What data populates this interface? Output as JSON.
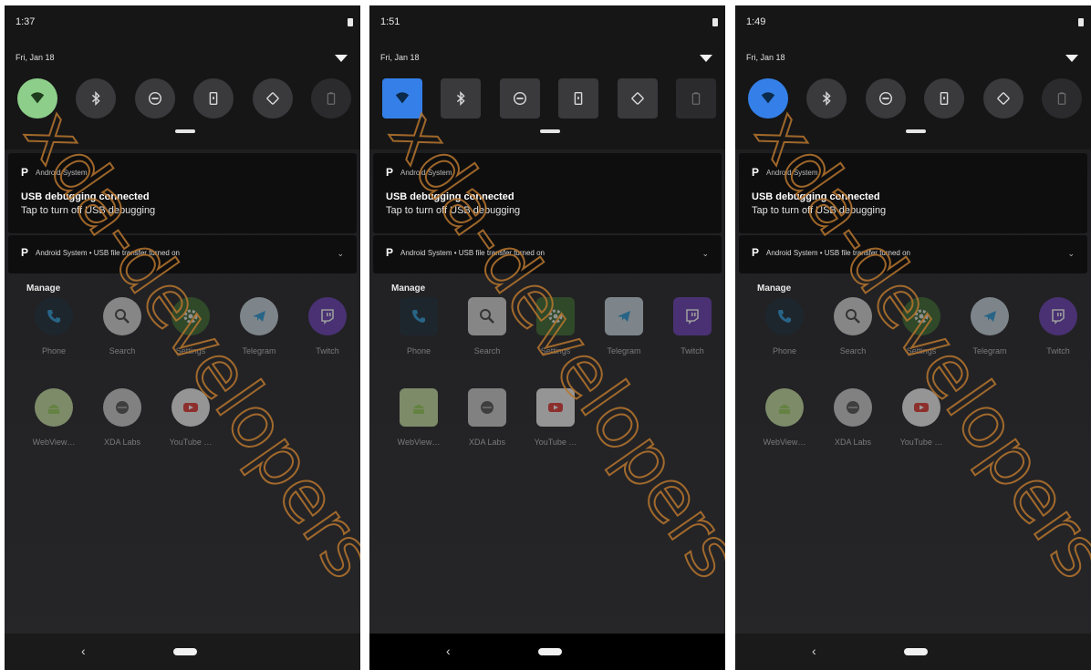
{
  "colors": {
    "tile_active_green": "#8dcf8a",
    "tile_active_blue": "#3480e8",
    "tile_inactive": "#3a3a3d",
    "watermark": "#b8762e"
  },
  "watermark_text": "xda-developers",
  "screens": [
    {
      "time": "1:37",
      "date": "Fri, Jan 18",
      "tile_style": "circle",
      "tiles": [
        {
          "icon": "wifi-icon",
          "active": true,
          "accent": "green"
        },
        {
          "icon": "bluetooth-icon",
          "active": false
        },
        {
          "icon": "do-not-disturb-icon",
          "active": false
        },
        {
          "icon": "flashlight-icon",
          "active": false
        },
        {
          "icon": "auto-rotate-icon",
          "active": false
        },
        {
          "icon": "battery-saver-icon",
          "active": false
        }
      ],
      "notification": {
        "app": "Android System",
        "title": "USB debugging connected",
        "text": "Tap to turn off USB debugging"
      },
      "collapsed_notification": "Android System • USB file transfer turned on",
      "manage_label": "Manage",
      "apps": [
        {
          "label": "Phone",
          "icon": "phone-icon"
        },
        {
          "label": "Search",
          "icon": "search-icon"
        },
        {
          "label": "Settings",
          "icon": "gear-icon"
        },
        {
          "label": "Telegram",
          "icon": "telegram-icon"
        },
        {
          "label": "Twitch",
          "icon": "twitch-icon"
        },
        {
          "label": "WebView…",
          "icon": "android-icon"
        },
        {
          "label": "XDA Labs",
          "icon": "xda-labs-icon"
        },
        {
          "label": "YouTube …",
          "icon": "youtube-icon"
        }
      ]
    },
    {
      "time": "1:51",
      "date": "Fri, Jan 18",
      "tile_style": "square",
      "tiles": [
        {
          "icon": "wifi-icon",
          "active": true,
          "accent": "blue"
        },
        {
          "icon": "bluetooth-icon",
          "active": false
        },
        {
          "icon": "do-not-disturb-icon",
          "active": false
        },
        {
          "icon": "flashlight-icon",
          "active": false
        },
        {
          "icon": "auto-rotate-icon",
          "active": false
        },
        {
          "icon": "battery-saver-icon",
          "active": false
        }
      ],
      "notification": {
        "app": "Android System",
        "title": "USB debugging connected",
        "text": "Tap to turn off USB debugging"
      },
      "collapsed_notification": "Android System • USB file transfer turned on",
      "manage_label": "Manage",
      "apps": [
        {
          "label": "Phone",
          "icon": "phone-icon"
        },
        {
          "label": "Search",
          "icon": "search-icon"
        },
        {
          "label": "Settings",
          "icon": "gear-icon"
        },
        {
          "label": "Telegram",
          "icon": "telegram-icon"
        },
        {
          "label": "Twitch",
          "icon": "twitch-icon"
        },
        {
          "label": "WebView…",
          "icon": "android-icon"
        },
        {
          "label": "XDA Labs",
          "icon": "xda-labs-icon"
        },
        {
          "label": "YouTube …",
          "icon": "youtube-icon"
        }
      ]
    },
    {
      "time": "1:49",
      "date": "Fri, Jan 18",
      "tile_style": "circle",
      "tiles": [
        {
          "icon": "wifi-icon",
          "active": true,
          "accent": "blue"
        },
        {
          "icon": "bluetooth-icon",
          "active": false
        },
        {
          "icon": "do-not-disturb-icon",
          "active": false
        },
        {
          "icon": "flashlight-icon",
          "active": false
        },
        {
          "icon": "auto-rotate-icon",
          "active": false
        },
        {
          "icon": "battery-saver-icon",
          "active": false
        }
      ],
      "notification": {
        "app": "Android System",
        "title": "USB debugging connected",
        "text": "Tap to turn off USB debugging"
      },
      "collapsed_notification": "Android System • USB file transfer turned on",
      "manage_label": "Manage",
      "apps": [
        {
          "label": "Phone",
          "icon": "phone-icon"
        },
        {
          "label": "Search",
          "icon": "search-icon"
        },
        {
          "label": "Settings",
          "icon": "gear-icon"
        },
        {
          "label": "Telegram",
          "icon": "telegram-icon"
        },
        {
          "label": "Twitch",
          "icon": "twitch-icon"
        },
        {
          "label": "WebView…",
          "icon": "android-icon"
        },
        {
          "label": "XDA Labs",
          "icon": "xda-labs-icon"
        },
        {
          "label": "YouTube …",
          "icon": "youtube-icon"
        }
      ]
    }
  ]
}
